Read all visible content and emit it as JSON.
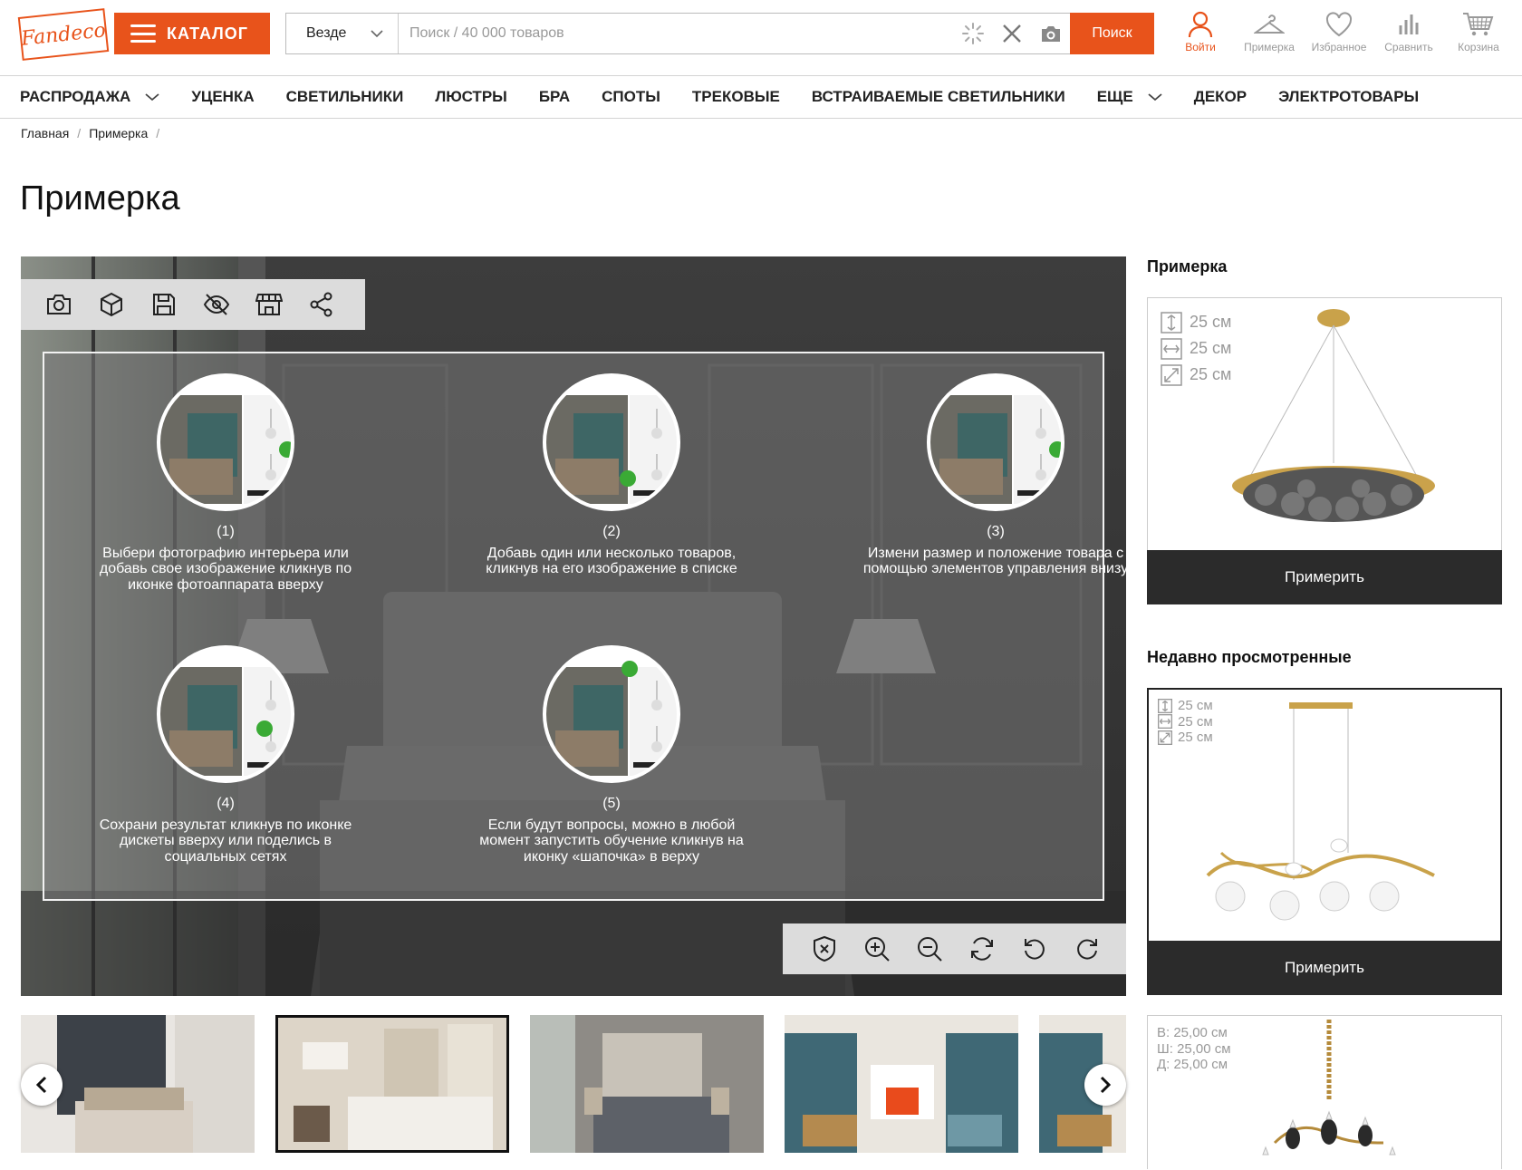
{
  "header": {
    "logo": "Fandeco",
    "catalog_label": "КАТАЛОГ",
    "search": {
      "scope": "Везде",
      "placeholder": "Поиск / 40 000 товаров",
      "button": "Поиск"
    },
    "icons": [
      {
        "name": "user-icon",
        "label": "Войти",
        "color": "#e8531b"
      },
      {
        "name": "hanger-icon",
        "label": "Примерка",
        "color": "#999999"
      },
      {
        "name": "heart-icon",
        "label": "Избранное",
        "color": "#999999"
      },
      {
        "name": "compare-icon",
        "label": "Сравнить",
        "color": "#999999"
      },
      {
        "name": "cart-icon",
        "label": "Корзина",
        "color": "#999999"
      }
    ]
  },
  "nav": {
    "items": [
      {
        "label": "РАСПРОДАЖА",
        "dropdown": true
      },
      {
        "label": "УЦЕНКА",
        "dropdown": false
      },
      {
        "label": "СВЕТИЛЬНИКИ",
        "dropdown": false
      },
      {
        "label": "ЛЮСТРЫ",
        "dropdown": false
      },
      {
        "label": "БРА",
        "dropdown": false
      },
      {
        "label": "СПОТЫ",
        "dropdown": false
      },
      {
        "label": "ТРЕКОВЫЕ",
        "dropdown": false
      },
      {
        "label": "ВСТРАИВАЕМЫЕ СВЕТИЛЬНИКИ",
        "dropdown": false
      },
      {
        "label": "ЕЩЕ",
        "dropdown": true
      },
      {
        "label": "ДЕКОР",
        "dropdown": false
      },
      {
        "label": "ЭЛЕКТРОТОВАРЫ",
        "dropdown": false
      }
    ]
  },
  "breadcrumb": {
    "home": "Главная",
    "current": "Примерка",
    "sep": "/"
  },
  "page_title": "Примерка",
  "viewer": {
    "top_tools": [
      "camera-icon",
      "cube-icon",
      "save-icon",
      "eye-off-icon",
      "store-icon",
      "share-icon"
    ],
    "bottom_tools": [
      "shield-x-icon",
      "zoom-in-icon",
      "zoom-out-icon",
      "refresh-icon",
      "rotate-left-icon",
      "rotate-right-icon"
    ],
    "steps": [
      {
        "num": "(1)",
        "text": "Выбери фотографию интерьера или добавь свое изображение кликнув по иконке фотоаппарата вверху"
      },
      {
        "num": "(2)",
        "text": "Добавь один или несколько товаров, кликнув на его изображение в списке"
      },
      {
        "num": "(3)",
        "text": "Измени размер и положение товара с помощью элементов управления внизу"
      },
      {
        "num": "(4)",
        "text": "Сохрани результат кликнув по иконке дискеты вверху или поделись в социальных сетях"
      },
      {
        "num": "(5)",
        "text": "Если будут вопросы, можно в любой момент запустить обучение кликнув на иконку «шапочка» в верху"
      }
    ]
  },
  "sidebar": {
    "tryon_title": "Примерка",
    "tryon_card": {
      "height": "25 см",
      "width": "25 см",
      "depth": "25 см",
      "button": "Примерить"
    },
    "recent_title": "Недавно просмотренные",
    "recent_cards": [
      {
        "height": "25 см",
        "width": "25 см",
        "depth": "25 см",
        "button": "Примерить"
      },
      {
        "height": "В: 25,00 см",
        "width": "Ш: 25,00 см",
        "depth": "Д: 25,00 см"
      }
    ]
  },
  "colors": {
    "accent": "#e8531b",
    "dark_button": "#2b2b2b",
    "icon_gray": "#999999"
  }
}
